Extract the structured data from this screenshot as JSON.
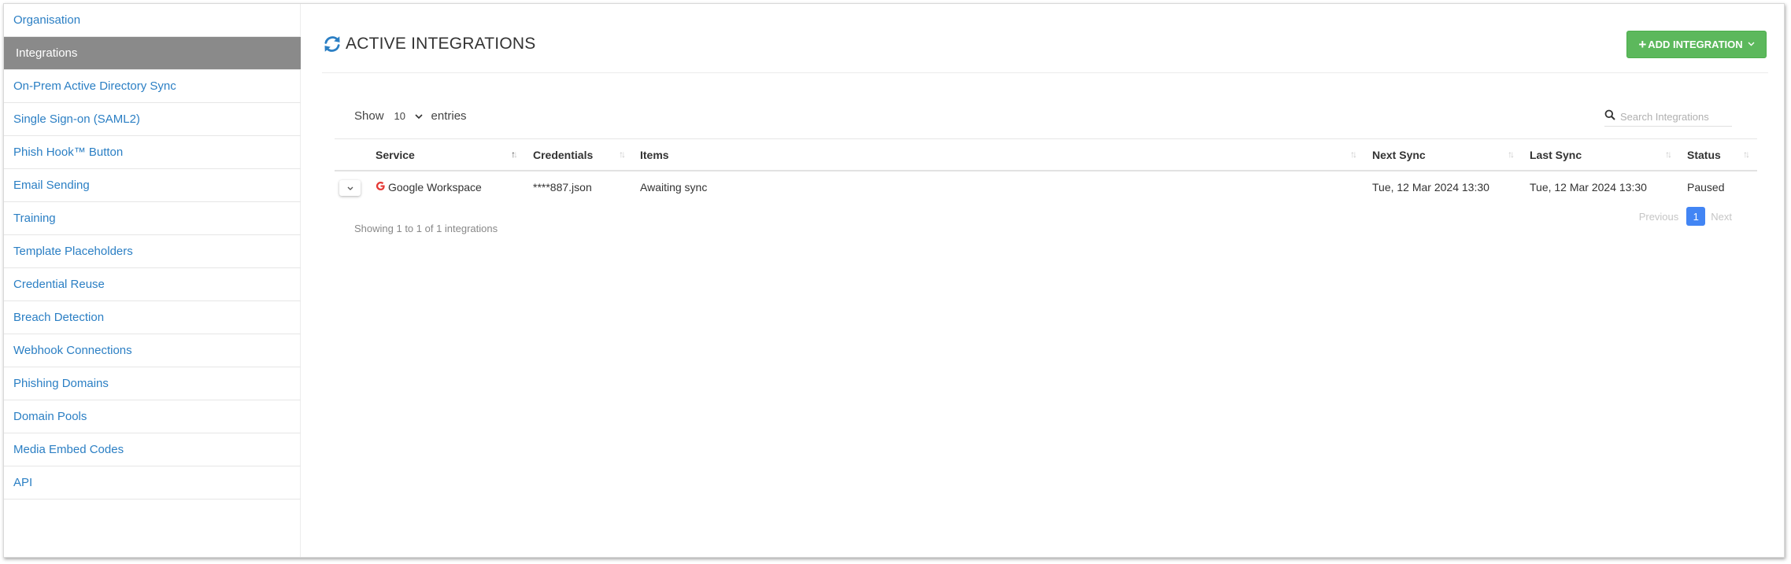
{
  "sidebar": {
    "items": [
      {
        "label": "Organisation",
        "active": false
      },
      {
        "label": "Integrations",
        "active": true
      },
      {
        "label": "On-Prem Active Directory Sync",
        "active": false
      },
      {
        "label": "Single Sign-on (SAML2)",
        "active": false
      },
      {
        "label": "Phish Hook™ Button",
        "active": false
      },
      {
        "label": "Email Sending",
        "active": false
      },
      {
        "label": "Training",
        "active": false
      },
      {
        "label": "Template Placeholders",
        "active": false
      },
      {
        "label": "Credential Reuse",
        "active": false
      },
      {
        "label": "Breach Detection",
        "active": false
      },
      {
        "label": "Webhook Connections",
        "active": false
      },
      {
        "label": "Phishing Domains",
        "active": false
      },
      {
        "label": "Domain Pools",
        "active": false
      },
      {
        "label": "Media Embed Codes",
        "active": false
      },
      {
        "label": "API",
        "active": false
      }
    ]
  },
  "header": {
    "title": "ACTIVE INTEGRATIONS",
    "title_icon": "sync-icon",
    "add_button_label": "ADD INTEGRATION",
    "add_button_color": "#5cb85c"
  },
  "controls": {
    "show_label": "Show",
    "entries_value": "10",
    "entries_label": "entries",
    "search_placeholder": "Search Integrations"
  },
  "table": {
    "columns": [
      "Service",
      "Credentials",
      "Items",
      "Next Sync",
      "Last Sync",
      "Status"
    ],
    "rows": [
      {
        "service": "Google Workspace",
        "service_icon": "google-icon",
        "credentials": "****887.json",
        "items": "Awaiting sync",
        "next_sync": "Tue, 12 Mar 2024 13:30",
        "last_sync": "Tue, 12 Mar 2024 13:30",
        "status": "Paused"
      }
    ]
  },
  "footer": {
    "info": "Showing 1 to 1 of 1 integrations",
    "previous_label": "Previous",
    "current_page": "1",
    "next_label": "Next",
    "page_color": "#4285f4"
  },
  "colors": {
    "link": "#2b7fc4",
    "active_sidebar_bg": "#8a8a8a"
  }
}
